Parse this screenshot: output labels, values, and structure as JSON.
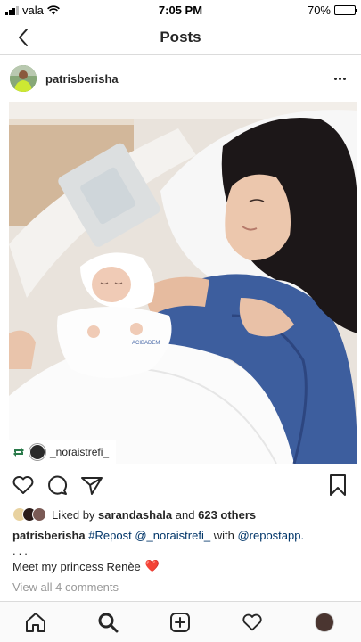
{
  "status_bar": {
    "carrier": "vala",
    "time": "7:05 PM",
    "battery": "70%",
    "battery_level": 0.7
  },
  "nav": {
    "title": "Posts",
    "back_icon": "chevron-left-icon"
  },
  "post": {
    "username": "patrisberisha",
    "more_icon": "more-horizontal-icon",
    "repost_tag": "_noraistrefi_",
    "likes": {
      "prefix": "Liked by",
      "user": "sarandashala",
      "connector": "and",
      "others": "623 others"
    },
    "caption": {
      "username": "patrisberisha",
      "hashtag": "#Repost",
      "mention1": "@_noraistrefi_",
      "with_text": "with",
      "mention2": "@repostapp",
      "end": ".",
      "dots": "...",
      "line2": "Meet my princess Renèe",
      "emoji": "❤️"
    },
    "view_comments": "View all 4 comments"
  },
  "colors": {
    "link": "#003569",
    "muted": "#999999",
    "heart": "#e0245e"
  }
}
